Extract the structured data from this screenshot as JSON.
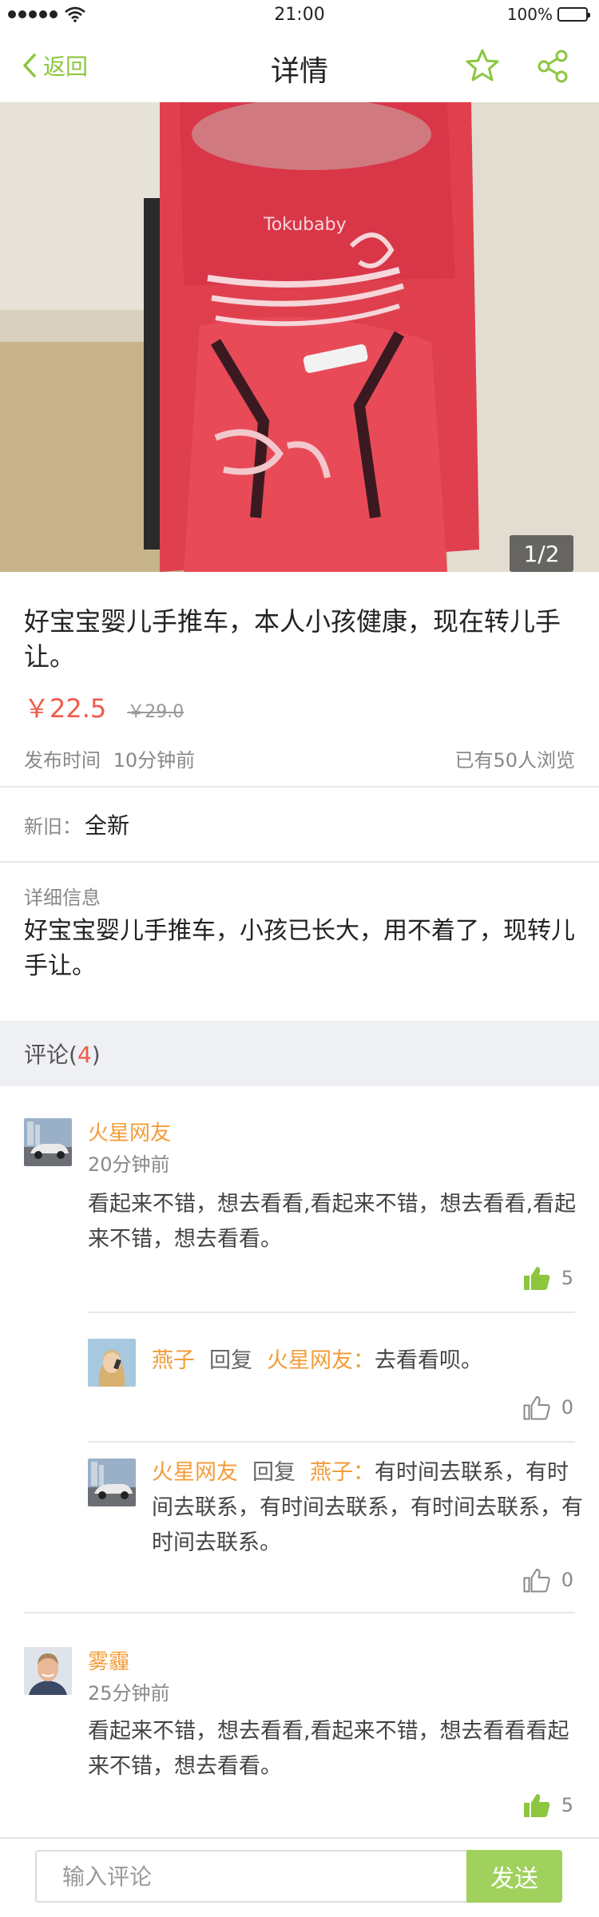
{
  "status_bar": {
    "time": "21:00",
    "battery": "100%"
  },
  "nav": {
    "back_label": "返回",
    "title": "详情",
    "icons": [
      "star-icon",
      "share-icon"
    ]
  },
  "gallery": {
    "counter": "1/2"
  },
  "product": {
    "title": "好宝宝婴儿手推车，本人小孩健康，现在转儿手让。",
    "price_current": "￥22.5",
    "price_original": "￥29.0",
    "publish_label": "发布时间",
    "publish_time": "10分钟前",
    "views": "已有50人浏览",
    "condition_label": "新旧：",
    "condition_value": "全新",
    "detail_label": "详细信息",
    "detail_text": "好宝宝婴儿手推车，小孩已长大，用不着了，现转儿手让。"
  },
  "comments": {
    "header_label": "评论(",
    "count": "4",
    "header_close": ")",
    "items": [
      {
        "name": "火星网友",
        "time": "20分钟前",
        "text": "看起来不错，想去看看,看起来不错，想去看看,看起来不错，想去看看。",
        "likes": "5",
        "replies": [
          {
            "name": "燕子",
            "reply_word": "回复",
            "to": "火星网友：",
            "text": "去看看呗。",
            "likes": "0"
          },
          {
            "name": "火星网友",
            "reply_word": "回复",
            "to": "燕子：",
            "text": "有时间去联系，有时间去联系，有时间去联系，有时间去联系，有时间去联系。",
            "likes": "0"
          }
        ]
      },
      {
        "name": "雾霾",
        "time": "25分钟前",
        "text": "看起来不错，想去看看,看起来不错，想去看看看起来不错，想去看看。",
        "likes": "5"
      }
    ]
  },
  "input_bar": {
    "placeholder": "输入评论",
    "send_label": "发送"
  },
  "colors": {
    "accent_green": "#8cc63f",
    "send_green": "#9fd15c",
    "price_red": "#f05a4b",
    "name_orange": "#f39c38"
  }
}
